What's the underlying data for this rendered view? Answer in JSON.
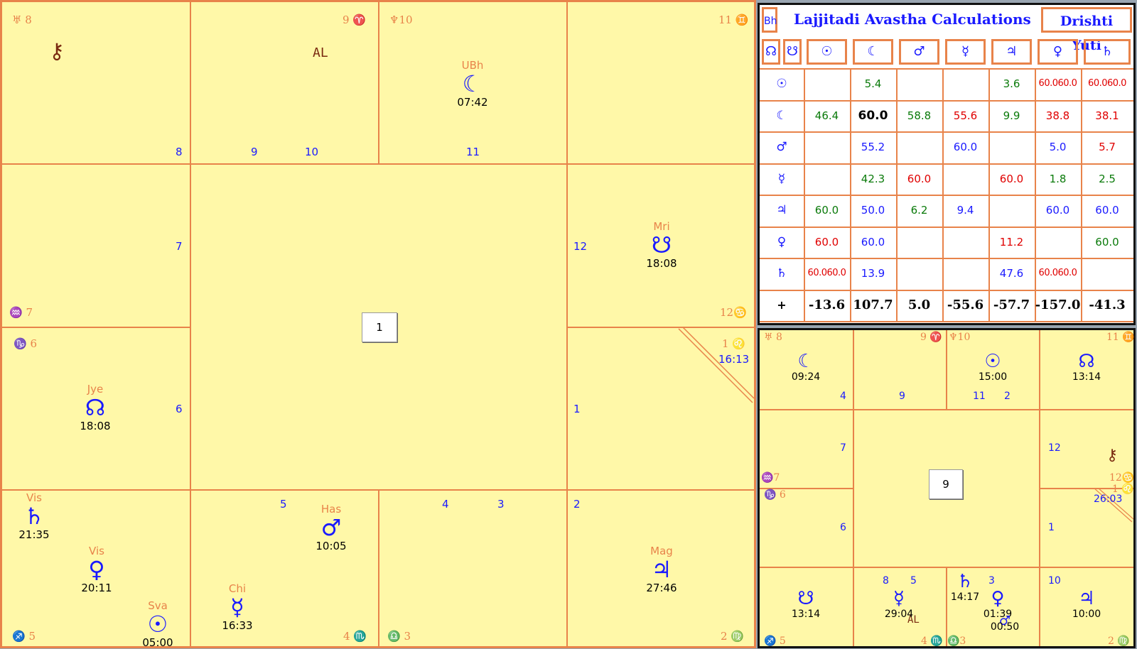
{
  "main_chart": {
    "center_label": "1",
    "signs": {
      "h8": "♅ 8",
      "h9": "9 ♈",
      "h10": "♆10",
      "h11": "11 ♊",
      "h7": "♒ 7",
      "h12": "12♋",
      "h6": "♑ 6",
      "h1": "1 ♌",
      "h5": "♐ 5",
      "h4": "4 ♏",
      "h3": "♎ 3",
      "h2": "2 ♍"
    },
    "house_numbers": [
      "8",
      "9",
      "10",
      "11",
      "7",
      "12",
      "6",
      "1",
      "5",
      "4",
      "3",
      "2"
    ],
    "houses_asc_degree": "16:13",
    "labels": {
      "al": "AL",
      "chiron": "⚷"
    },
    "planets": [
      {
        "nak": "UBh",
        "glyph": "☾",
        "deg": "07:42"
      },
      {
        "nak": "Mri",
        "glyph": "☋",
        "deg": "18:08"
      },
      {
        "nak": "Jye",
        "glyph": "☊",
        "deg": "18:08"
      },
      {
        "nak": "Vis",
        "glyph": "♄",
        "deg": "21:35"
      },
      {
        "nak": "Vis",
        "glyph": "♀",
        "deg": "20:11"
      },
      {
        "nak": "Sva",
        "glyph": "☉",
        "deg": "05:00"
      },
      {
        "nak": "Has",
        "glyph": "♂",
        "deg": "10:05"
      },
      {
        "nak": "Chi",
        "glyph": "☿",
        "deg": "16:33"
      },
      {
        "nak": "Mag",
        "glyph": "♃",
        "deg": "27:46"
      }
    ]
  },
  "table": {
    "corner_label": "Bh",
    "title": "Lajjitadi Avastha Calculations",
    "drishti_label": "Drishti Yuti",
    "node_headers": [
      "☊",
      "☋"
    ],
    "col_headers": [
      "☉",
      "☾",
      "♂",
      "☿",
      "♃",
      "♀",
      "♄"
    ],
    "row_headers": [
      "☉",
      "☾",
      "♂",
      "☿",
      "♃",
      "♀",
      "♄",
      "+"
    ],
    "rows": [
      [
        {
          "v": "",
          "c": "g"
        },
        {
          "v": "5.4",
          "c": "g"
        },
        {
          "v": "",
          "c": "g"
        },
        {
          "v": "",
          "c": "g"
        },
        {
          "v": "3.6",
          "c": "g"
        },
        {
          "v": "60.060.0",
          "c": "r"
        },
        {
          "v": "60.060.0",
          "c": "r"
        }
      ],
      [
        {
          "v": "46.4",
          "c": "g"
        },
        {
          "v": "60.0",
          "c": "k"
        },
        {
          "v": "58.8",
          "c": "g"
        },
        {
          "v": "55.6",
          "c": "r"
        },
        {
          "v": "9.9",
          "c": "g"
        },
        {
          "v": "38.8",
          "c": "r"
        },
        {
          "v": "38.1",
          "c": "r"
        }
      ],
      [
        {
          "v": "",
          "c": "b"
        },
        {
          "v": "55.2",
          "c": "b"
        },
        {
          "v": "",
          "c": "b"
        },
        {
          "v": "60.0",
          "c": "b"
        },
        {
          "v": "",
          "c": "b"
        },
        {
          "v": "5.0",
          "c": "b"
        },
        {
          "v": "5.7",
          "c": "r"
        }
      ],
      [
        {
          "v": "",
          "c": "g"
        },
        {
          "v": "42.3",
          "c": "g"
        },
        {
          "v": "60.0",
          "c": "r"
        },
        {
          "v": "",
          "c": "g"
        },
        {
          "v": "60.0",
          "c": "r"
        },
        {
          "v": "1.8",
          "c": "g"
        },
        {
          "v": "2.5",
          "c": "g"
        }
      ],
      [
        {
          "v": "60.0",
          "c": "g"
        },
        {
          "v": "50.0",
          "c": "b"
        },
        {
          "v": "6.2",
          "c": "g"
        },
        {
          "v": "9.4",
          "c": "b"
        },
        {
          "v": "",
          "c": "g"
        },
        {
          "v": "60.0",
          "c": "b"
        },
        {
          "v": "60.0",
          "c": "b"
        }
      ],
      [
        {
          "v": "60.0",
          "c": "r"
        },
        {
          "v": "60.0",
          "c": "b"
        },
        {
          "v": "",
          "c": "g"
        },
        {
          "v": "",
          "c": "g"
        },
        {
          "v": "11.2",
          "c": "r"
        },
        {
          "v": "",
          "c": "g"
        },
        {
          "v": "60.0",
          "c": "g"
        }
      ],
      [
        {
          "v": "60.060.0",
          "c": "r"
        },
        {
          "v": "13.9",
          "c": "b"
        },
        {
          "v": "",
          "c": "g"
        },
        {
          "v": "",
          "c": "g"
        },
        {
          "v": "47.6",
          "c": "b"
        },
        {
          "v": "60.060.0",
          "c": "r"
        },
        {
          "v": "",
          "c": "g"
        }
      ]
    ],
    "totals": [
      "-13.6",
      "107.7",
      "5.0",
      "-55.6",
      "-57.7",
      "-157.0",
      "-41.3"
    ],
    "colors": {
      "g": "#0a7a0a",
      "r": "#e00000",
      "b": "#1a1aff",
      "k": "#000000"
    }
  },
  "small_chart": {
    "center_label": "9",
    "signs": {
      "h8": "♅ 8",
      "h9": "9 ♈",
      "h10": "♆10",
      "h11": "11 ♊",
      "h7": "♒7",
      "h12": "12♋",
      "h6": "♑ 6",
      "h1": "1 ♌",
      "h5": "♐ 5",
      "h4": "4 ♏",
      "h3": "♎3",
      "h2": "2 ♍"
    },
    "house_numbers": [
      "4",
      "9",
      "11",
      "2",
      "7",
      "12",
      "6",
      "1",
      "8",
      "5",
      "3",
      "10"
    ],
    "asc_degree": "26:03",
    "labels": {
      "al": "AL",
      "chiron": "⚷"
    },
    "planets": [
      {
        "glyph": "☾",
        "deg": "09:24"
      },
      {
        "glyph": "☉",
        "deg": "15:00"
      },
      {
        "glyph": "☊",
        "deg": "13:14"
      },
      {
        "glyph": "☋",
        "deg": "13:14"
      },
      {
        "glyph": "☿",
        "deg": "29:04"
      },
      {
        "glyph": "♄",
        "deg": "14:17"
      },
      {
        "glyph": "♀",
        "deg": "01:39"
      },
      {
        "glyph": "♂",
        "deg": "00:50"
      },
      {
        "glyph": "♃",
        "deg": "10:00"
      }
    ]
  }
}
